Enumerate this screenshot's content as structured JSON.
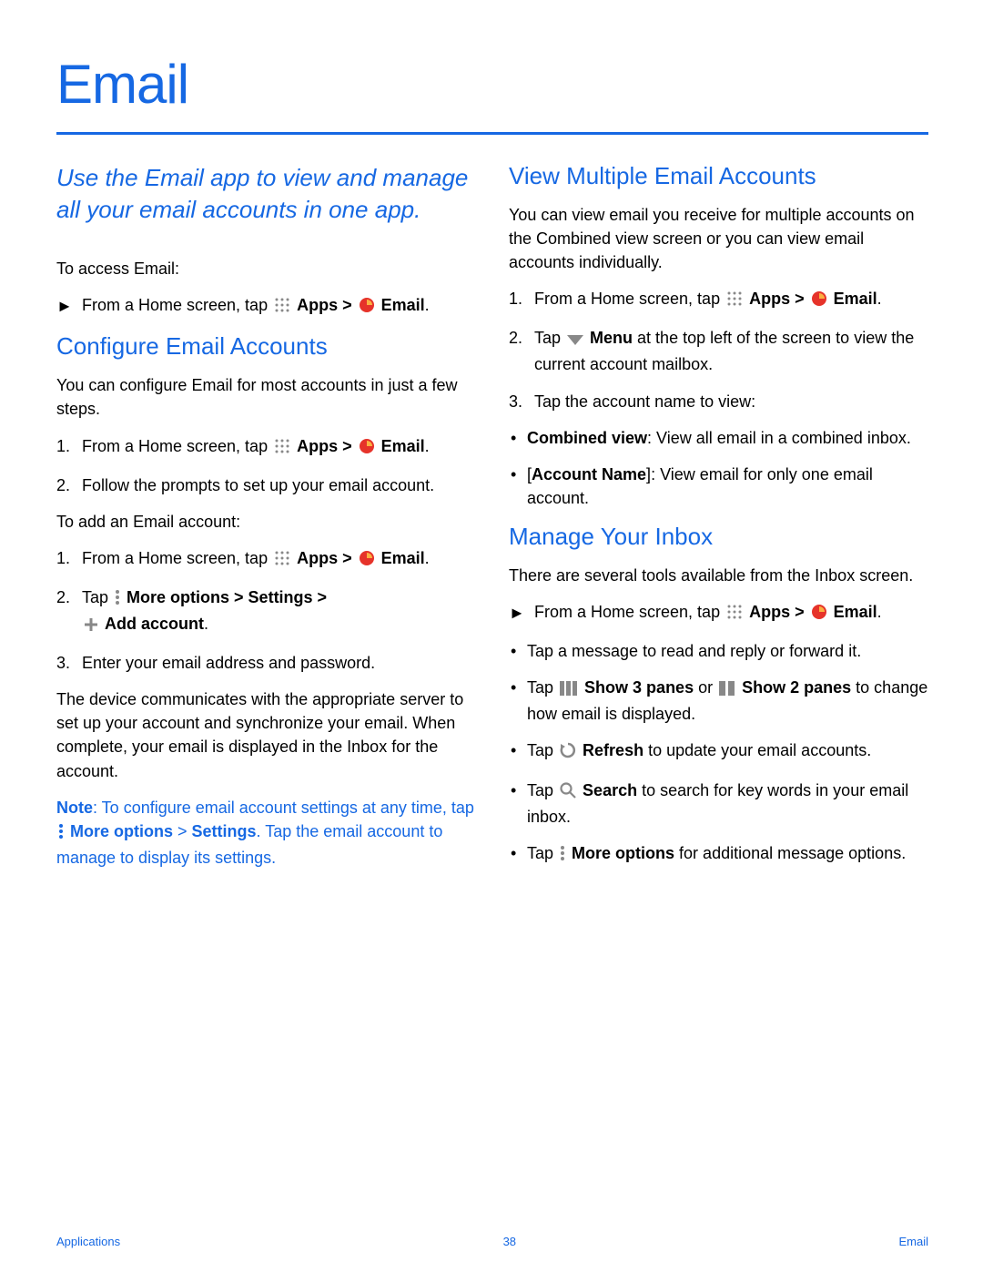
{
  "title": "Email",
  "intro": "Use the Email app to view and manage all your email accounts in one app.",
  "access_label": "To access Email:",
  "from_home_tap": "From a Home screen, tap ",
  "apps": "Apps",
  "email": "Email",
  "gt": " > ",
  "dot": ".",
  "configure": {
    "heading": "Configure Email Accounts",
    "para": "You can configure Email for most accounts in just a few steps.",
    "step2": "Follow the prompts to set up your email account.",
    "add_label": "To add an Email account:",
    "step2b_tap": "Tap ",
    "step2b_more": "More options > Settings >",
    "step2b_add": "Add account",
    "step3": "Enter your email address and password.",
    "para2": "The device communicates with the appropriate server to set up your account and synchronize your email. When complete, your email is displayed in the Inbox for the account.",
    "note_label": "Note",
    "note_1": ": To configure email account settings at any time, tap ",
    "note_more": "More options",
    "note_gt": " > ",
    "note_settings": "Settings",
    "note_2": ". Tap the email account to manage to display its settings."
  },
  "view": {
    "heading": "View Multiple Email Accounts",
    "para": "You can view email you receive for multiple accounts on the Combined view screen or you can view email accounts individually.",
    "step2_tap": "Tap ",
    "step2_menu": "Menu",
    "step2_rest": " at the top left of the screen to view the current account mailbox.",
    "step3": "Tap the account name to view:",
    "bullet1_label": "Combined view",
    "bullet1_rest": ": View all email in a combined inbox.",
    "bullet2_label": "[",
    "bullet2_name": "Account Name",
    "bullet2_close": "]",
    "bullet2_rest": ": View email for only one email account."
  },
  "manage": {
    "heading": "Manage Your Inbox",
    "para": "There are several tools available from the Inbox screen.",
    "b1": "Tap a message to read and reply or forward it.",
    "b2_tap": "Tap ",
    "b2_s3": "Show 3 panes",
    "b2_or": " or ",
    "b2_s2": "Show 2 panes",
    "b2_rest": " to change how email is displayed.",
    "b3_tap": "Tap ",
    "b3_refresh": "Refresh",
    "b3_rest": " to update your email accounts.",
    "b4_tap": "Tap ",
    "b4_search": "Search",
    "b4_rest": " to search for key words in your email inbox.",
    "b5_tap": "Tap ",
    "b5_more": "More options",
    "b5_rest": " for additional message options."
  },
  "footer": {
    "left": "Applications",
    "center": "38",
    "right": "Email"
  }
}
